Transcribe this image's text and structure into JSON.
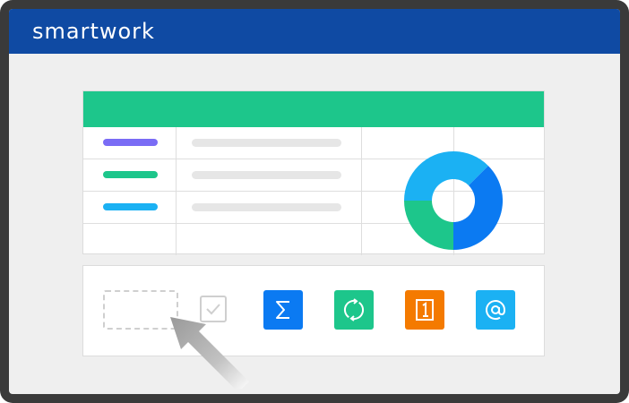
{
  "app": {
    "brand": "smartwork"
  },
  "colors": {
    "topbar": "#0f4aa3",
    "sheet_header": "#1dc68b",
    "purple": "#7a6cf5",
    "green": "#1dc68b",
    "sky": "#1bb1f3",
    "blue": "#0b7af2",
    "orange": "#f47a00"
  },
  "sheet": {
    "rows": [
      {
        "tag_color": "purple"
      },
      {
        "tag_color": "green"
      },
      {
        "tag_color": "sky"
      },
      {
        "tag_color": null
      }
    ],
    "donut": {
      "segments": [
        "sky",
        "blue",
        "green"
      ]
    }
  },
  "toolbar": {
    "tools": [
      {
        "name": "sum-tool",
        "icon": "sigma-icon",
        "color": "blue"
      },
      {
        "name": "sync-tool",
        "icon": "refresh-icon",
        "color": "green"
      },
      {
        "name": "number-tool",
        "icon": "number-one-icon",
        "color": "orange"
      },
      {
        "name": "mention-tool",
        "icon": "at-sign-icon",
        "color": "sky"
      }
    ]
  }
}
